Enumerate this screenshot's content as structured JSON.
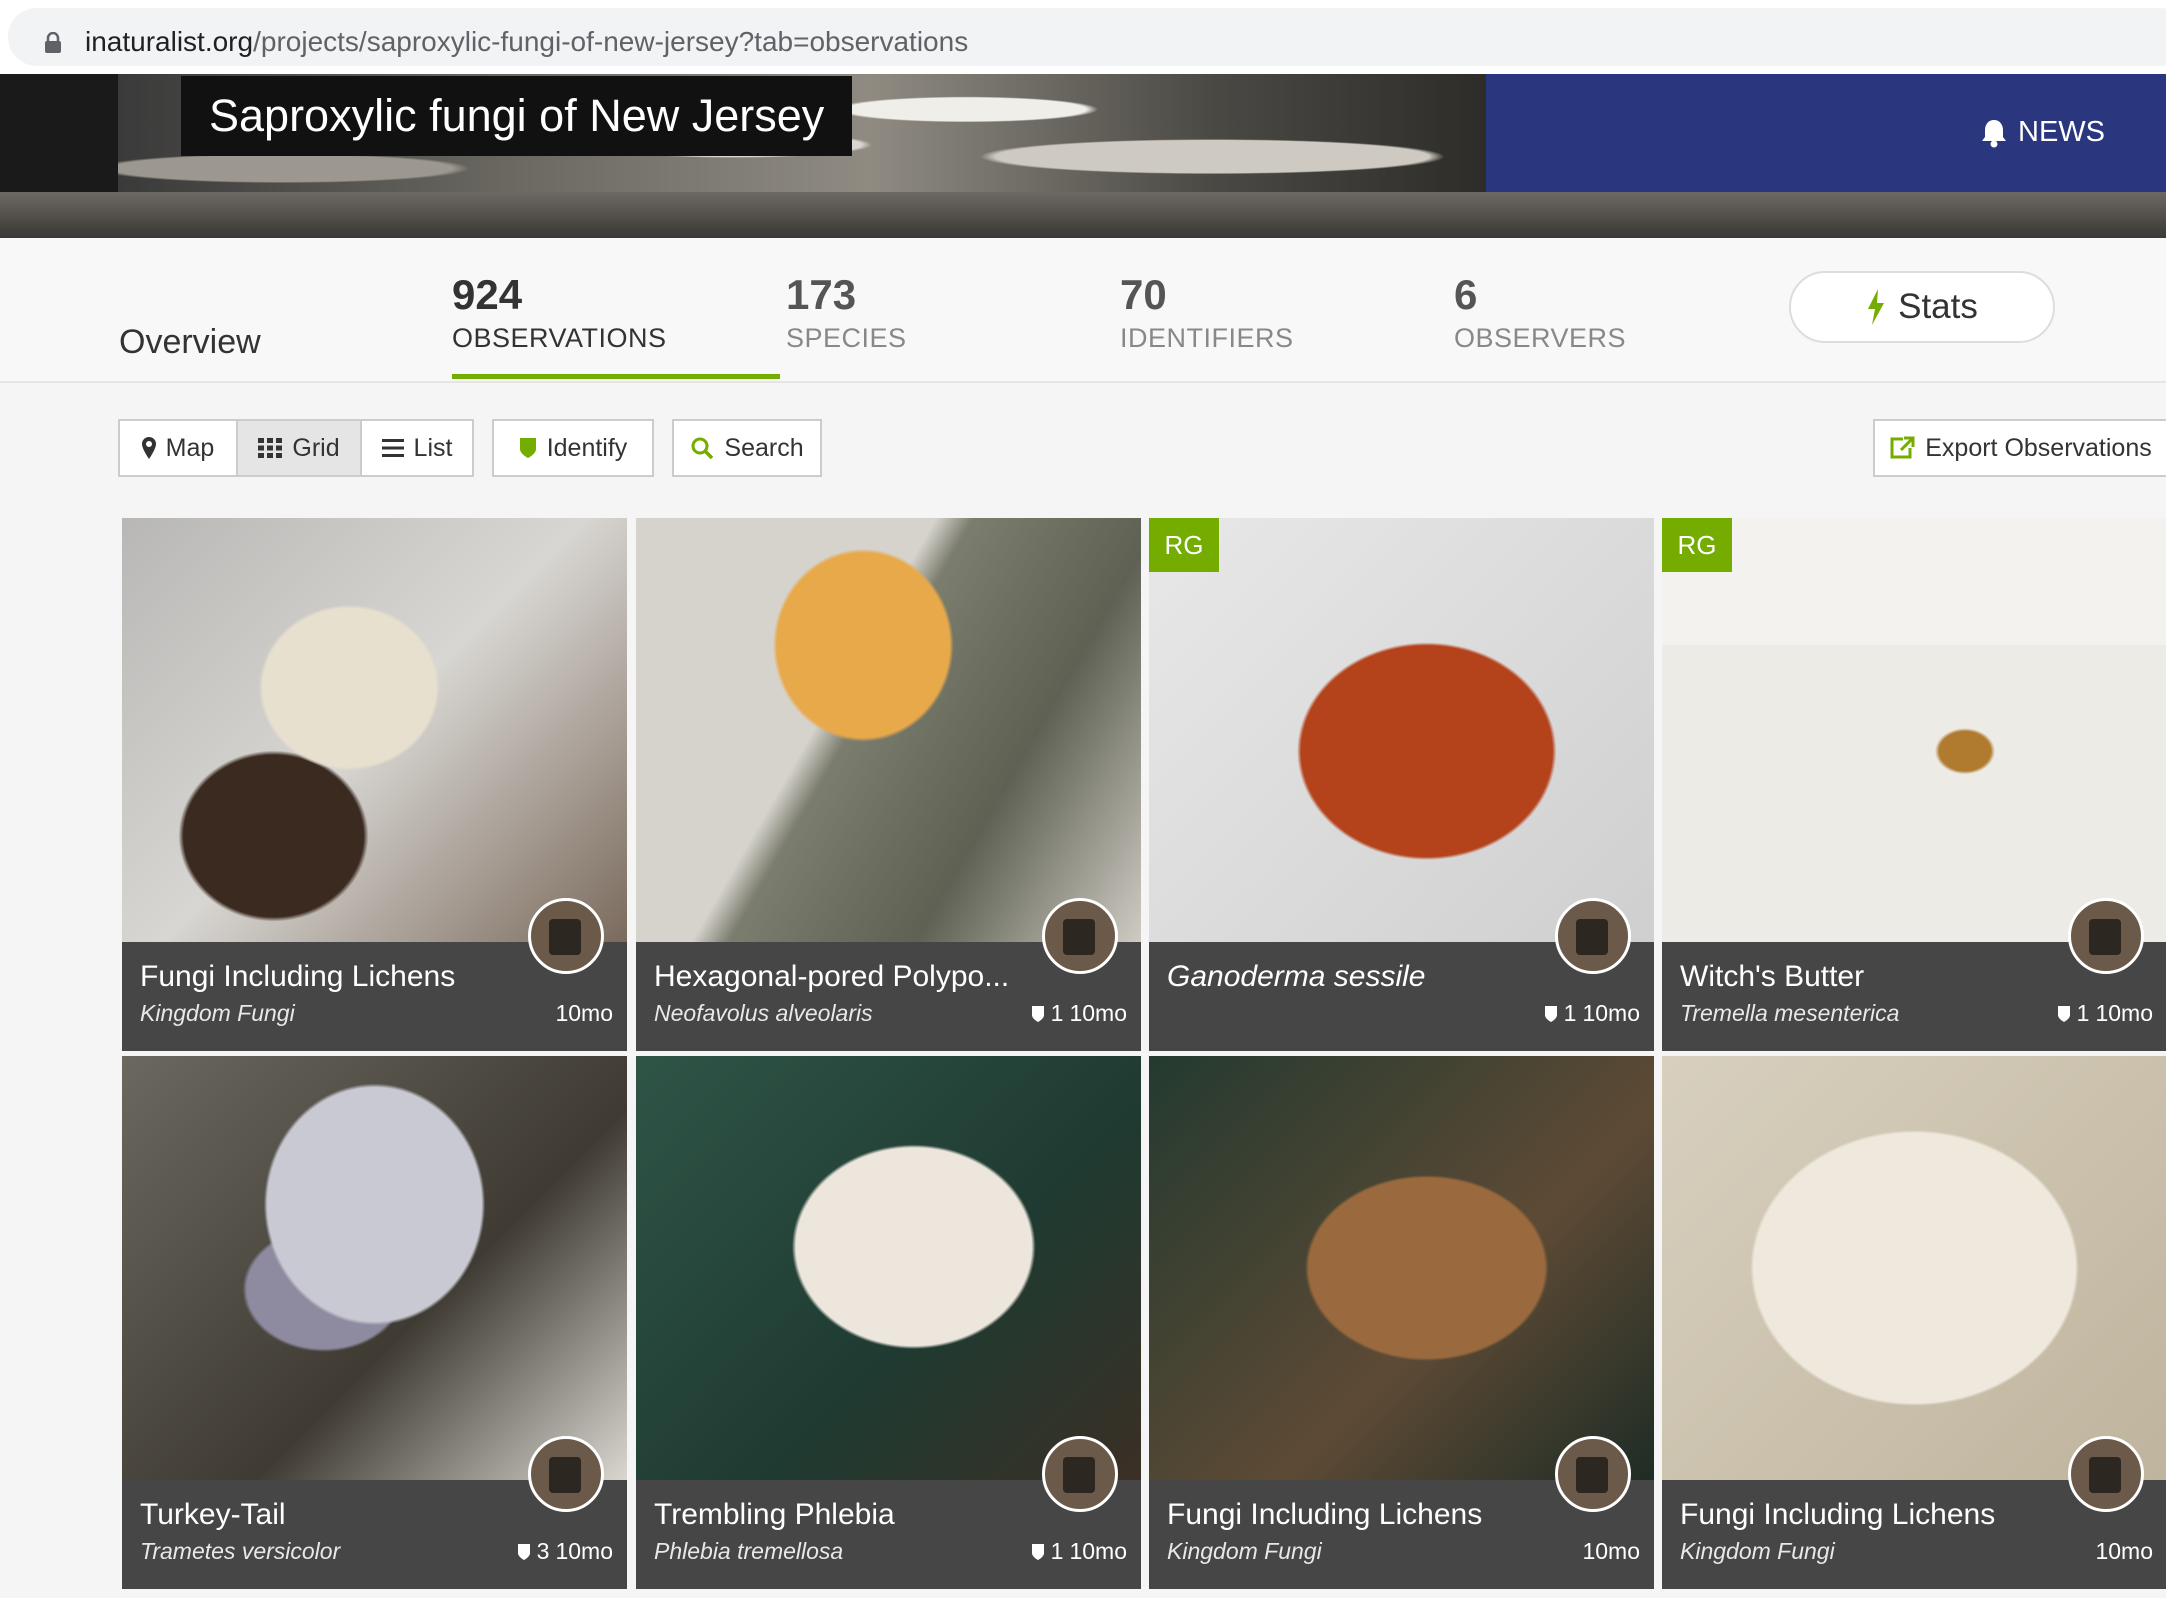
{
  "browser": {
    "url_host": "inaturalist.org",
    "url_path": "/projects/saproxylic-fungi-of-new-jersey?tab=observations"
  },
  "project": {
    "title": "Saproxylic fungi of New Jersey",
    "news_label": "NEWS"
  },
  "stats": {
    "overview_label": "Overview",
    "tabs": [
      {
        "num": "924",
        "label": "OBSERVATIONS"
      },
      {
        "num": "173",
        "label": "SPECIES"
      },
      {
        "num": "70",
        "label": "IDENTIFIERS"
      },
      {
        "num": "6",
        "label": "OBSERVERS"
      }
    ],
    "stats_button": "Stats"
  },
  "toolbar": {
    "map": "Map",
    "grid": "Grid",
    "list": "List",
    "identify": "Identify",
    "search": "Search",
    "export": "Export Observations"
  },
  "observations": [
    {
      "name": "Fungi Including Lichens",
      "sci": "Kingdom Fungi",
      "ids": "",
      "age": "10mo",
      "rg": ""
    },
    {
      "name": "Hexagonal-pored Polypo...",
      "sci": "Neofavolus alveolaris",
      "ids": "1",
      "age": "10mo",
      "rg": ""
    },
    {
      "name": "Ganoderma sessile",
      "sci": "",
      "ids": "1",
      "age": "10mo",
      "rg": "RG"
    },
    {
      "name": "Witch's Butter",
      "sci": "Tremella mesenterica",
      "ids": "1",
      "age": "10mo",
      "rg": "RG"
    },
    {
      "name": "Turkey-Tail",
      "sci": "Trametes versicolor",
      "ids": "3",
      "age": "10mo",
      "rg": ""
    },
    {
      "name": "Trembling Phlebia",
      "sci": "Phlebia tremellosa",
      "ids": "1",
      "age": "10mo",
      "rg": ""
    },
    {
      "name": "Fungi Including Lichens",
      "sci": "Kingdom Fungi",
      "ids": "",
      "age": "10mo",
      "rg": ""
    },
    {
      "name": "Fungi Including Lichens",
      "sci": "Kingdom Fungi",
      "ids": "",
      "age": "10mo",
      "rg": ""
    }
  ],
  "colors": {
    "accent": "#74ac00",
    "news_bg": "#2a367d",
    "caption_bg": "#464646"
  }
}
